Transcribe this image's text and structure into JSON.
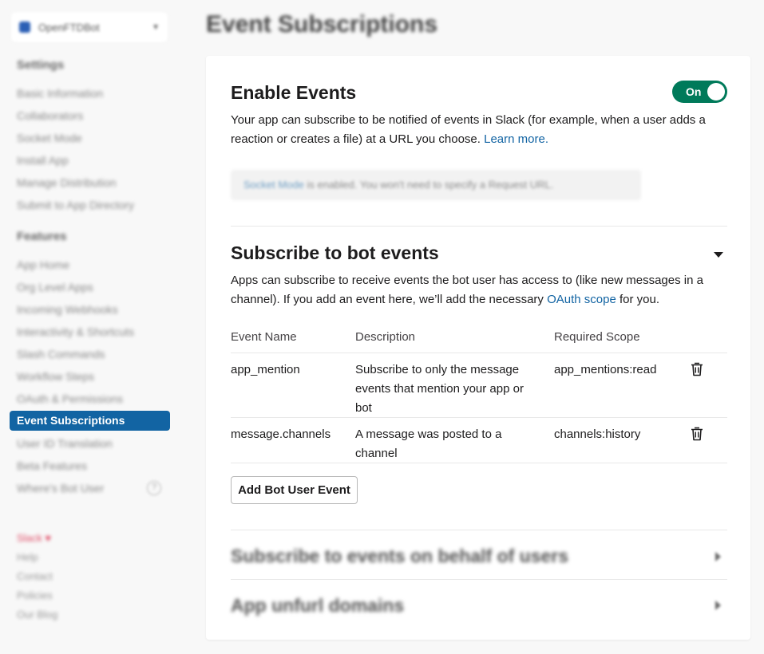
{
  "sidebar": {
    "app_name": "OpenFTDBot",
    "settings_heading": "Settings",
    "settings_items": [
      "Basic Information",
      "Collaborators",
      "Socket Mode",
      "Install App",
      "Manage Distribution",
      "Submit to App Directory"
    ],
    "features_heading": "Features",
    "features_items": [
      "App Home",
      "Org Level Apps",
      "Incoming Webhooks",
      "Interactivity & Shortcuts",
      "Slash Commands",
      "Workflow Steps",
      "OAuth & Permissions"
    ],
    "active_item": "Event Subscriptions",
    "after_items": [
      "User ID Translation",
      "Beta Features",
      "Where's Bot User"
    ],
    "footer": {
      "slack": "Slack ♥",
      "links": [
        "Help",
        "Contact",
        "Policies",
        "Our Blog"
      ]
    }
  },
  "page_title": "Event Subscriptions",
  "enable_events": {
    "title": "Enable Events",
    "toggle_label": "On",
    "description": "Your app can subscribe to be notified of events in Slack (for example, when a user adds a reaction or creates a file) at a URL you choose.",
    "learn_more": "Learn more.",
    "socket_link": "Socket Mode",
    "socket_note": " is enabled. You won't need to specify a Request URL."
  },
  "bot_events": {
    "title": "Subscribe to bot events",
    "description": "Apps can subscribe to receive events the bot user has access to (like new messages in a channel). If you add an event here, we’ll add the necessary",
    "oauth_link": "OAuth scope",
    "description_end": "for you.",
    "columns": {
      "name": "Event Name",
      "description": "Description",
      "scope": "Required Scope"
    },
    "rows": [
      {
        "name": "app_mention",
        "description": "Subscribe to only the message events that mention your app or bot",
        "scope": "app_mentions:read"
      },
      {
        "name": "message.channels",
        "description": "A message was posted to a channel",
        "scope": "channels:history"
      }
    ],
    "add_button": "Add Bot User Event"
  },
  "user_events": {
    "title": "Subscribe to events on behalf of users"
  },
  "unfurl": {
    "title": "App unfurl domains"
  }
}
